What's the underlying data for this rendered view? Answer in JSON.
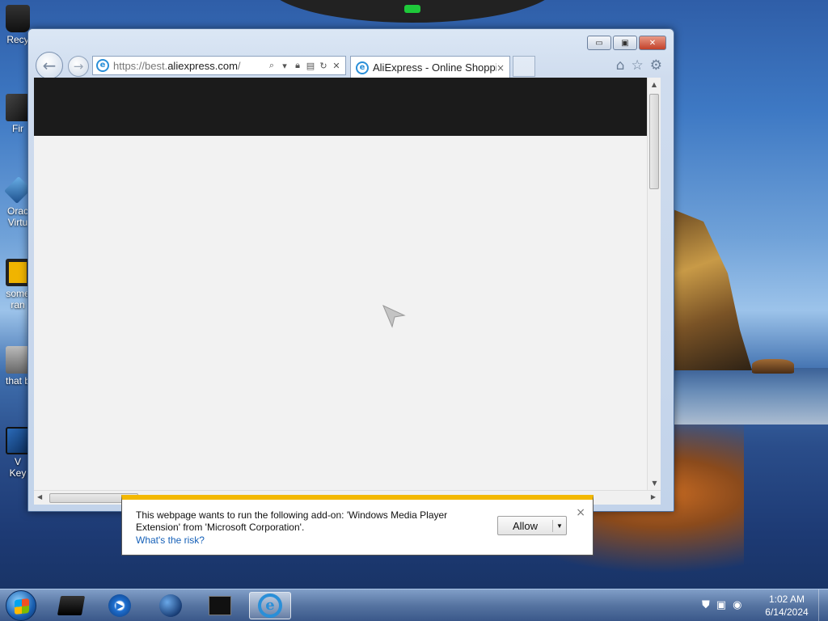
{
  "desktop": {
    "icons": [
      {
        "label": "Recy"
      },
      {
        "label": "Fir"
      },
      {
        "label": "Orac"
      },
      {
        "label": "Virtu"
      },
      {
        "label": "some"
      },
      {
        "label": "ran"
      },
      {
        "label": "that b"
      },
      {
        "label": "V"
      },
      {
        "label": "Key"
      }
    ]
  },
  "browser": {
    "address_url_prefix": "https://best.",
    "address_url_domain": "aliexpress.com",
    "address_url_suffix": "/",
    "tab_title": "AliExpress - Online Shoppi...",
    "tab_close": "×",
    "window_controls": {
      "minimize": "▭",
      "maximize": "▣",
      "close": "✕"
    },
    "toolbar_icons": [
      "home-icon",
      "favorites-star-icon",
      "gear-icon"
    ]
  },
  "notification": {
    "message": "This webpage wants to run the following add-on: 'Windows Media Player Extension' from 'Microsoft Corporation'.",
    "link": "What's the risk?",
    "allow_label": "Allow",
    "close": "×"
  },
  "taskbar": {
    "time": "1:02 AM",
    "date": "6/14/2024",
    "pinned": [
      "terminal-folder-icon",
      "media-player-icon",
      "globe-icon",
      "console-icon",
      "internet-explorer-icon"
    ]
  },
  "colors": {
    "notification_accent": "#f3b800",
    "link": "#1560b8",
    "page_header": "#1b1b1b"
  }
}
